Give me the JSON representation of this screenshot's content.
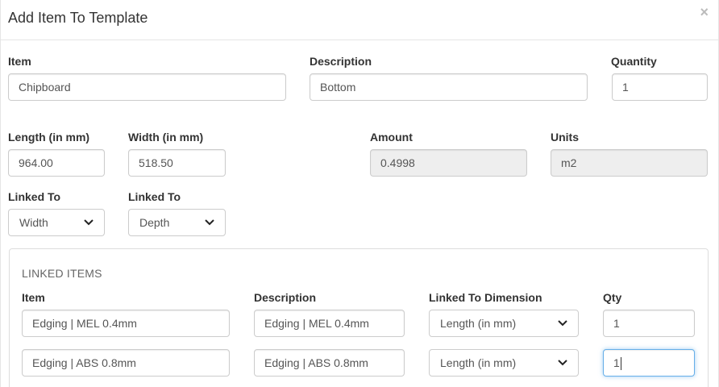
{
  "modal": {
    "title": "Add Item To Template",
    "close_symbol": "×"
  },
  "form": {
    "item_label": "Item",
    "item_value": "Chipboard",
    "description_label": "Description",
    "description_value": "Bottom",
    "quantity_label": "Quantity",
    "quantity_value": "1",
    "length_label": "Length (in mm)",
    "length_value": "964.00",
    "width_label": "Width (in mm)",
    "width_value": "518.50",
    "amount_label": "Amount",
    "amount_value": "0.4998",
    "units_label": "Units",
    "units_value": "m2",
    "linked_to_1_label": "Linked To",
    "linked_to_1_value": "Width",
    "linked_to_2_label": "Linked To",
    "linked_to_2_value": "Depth"
  },
  "linked_items": {
    "title": "LINKED ITEMS",
    "headers": {
      "item": "Item",
      "description": "Description",
      "dimension": "Linked To Dimension",
      "qty": "Qty"
    },
    "rows": [
      {
        "item": "Edging | MEL 0.4mm",
        "description": "Edging | MEL 0.4mm",
        "dimension": "Length (in mm)",
        "qty": "1"
      },
      {
        "item": "Edging | ABS 0.8mm",
        "description": "Edging | ABS 0.8mm",
        "dimension": "Length (in mm)",
        "qty": "1"
      }
    ]
  },
  "icons": {
    "select_arrow": "chevron-down-icon",
    "close": "close-icon"
  },
  "colors": {
    "focus_border": "#66afe9",
    "readonly_bg": "#eeeeee",
    "border": "#cccccc"
  }
}
